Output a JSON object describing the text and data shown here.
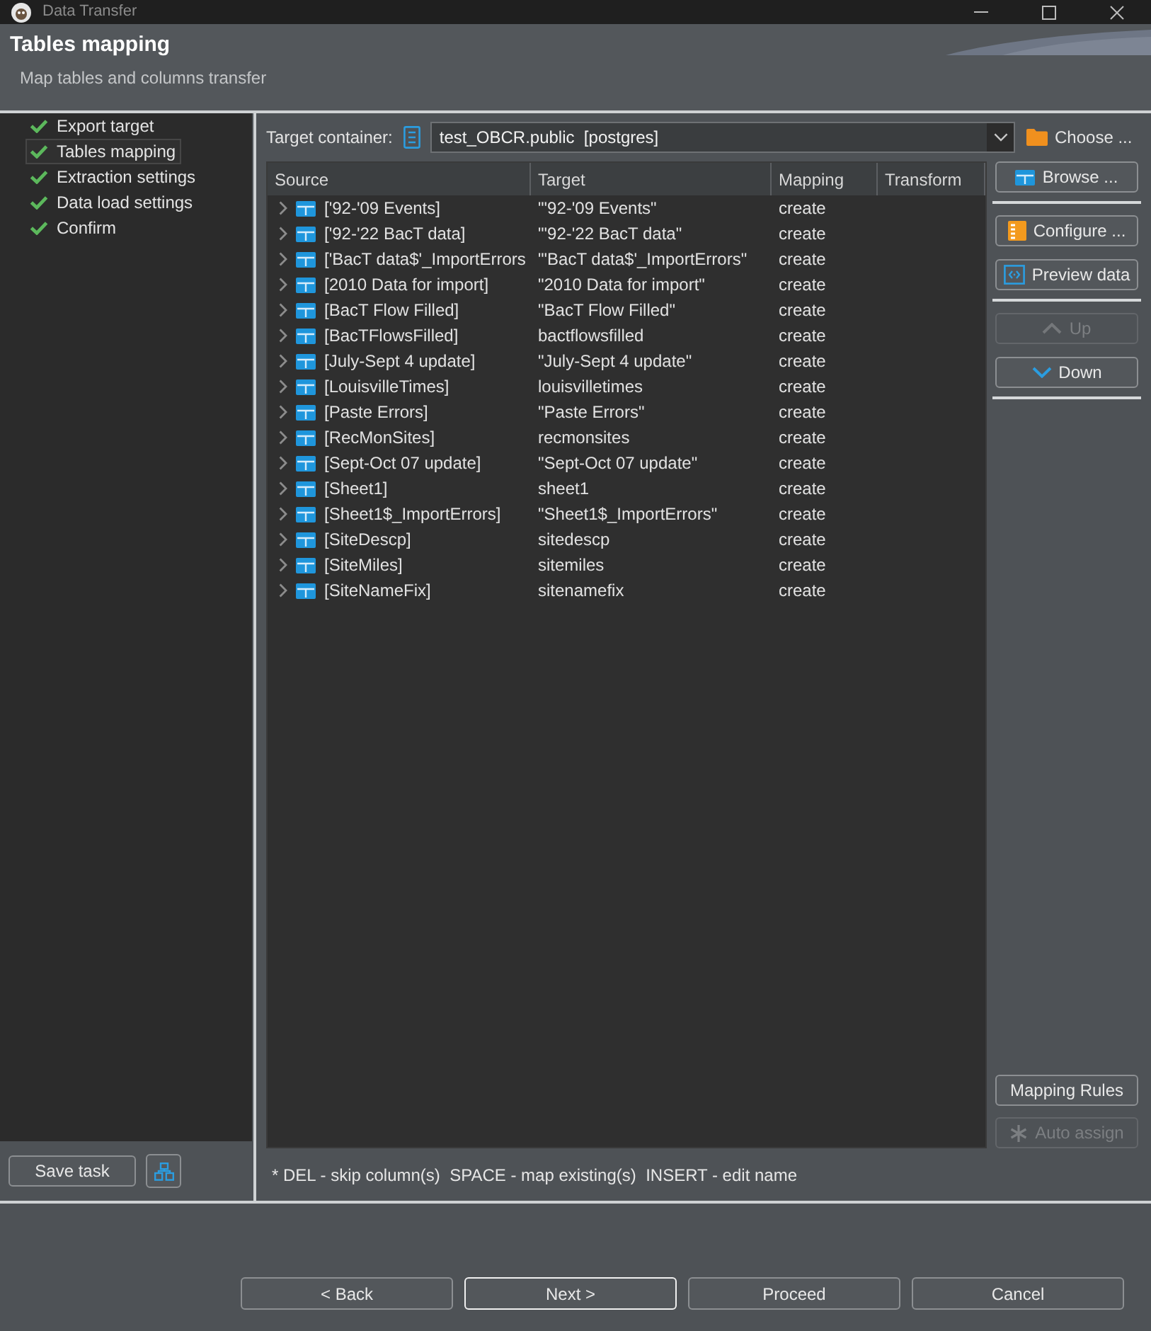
{
  "window": {
    "title": "Data Transfer"
  },
  "header": {
    "title": "Tables mapping",
    "subtitle": "Map tables and columns transfer"
  },
  "steps": [
    {
      "label": "Export target",
      "done": true,
      "selected": false
    },
    {
      "label": "Tables mapping",
      "done": true,
      "selected": true
    },
    {
      "label": "Extraction settings",
      "done": true,
      "selected": false
    },
    {
      "label": "Data load settings",
      "done": true,
      "selected": false
    },
    {
      "label": "Confirm",
      "done": true,
      "selected": false
    }
  ],
  "save_task": {
    "label": "Save task"
  },
  "target_container": {
    "label": "Target container:",
    "value": "test_OBCR.public  [postgres]",
    "choose_label": "Choose ..."
  },
  "table": {
    "columns": [
      "Source",
      "Target",
      "Mapping",
      "Transform"
    ],
    "rows": [
      {
        "source": "['92-'09 Events]",
        "target": "\"'92-'09 Events\"",
        "mapping": "create",
        "expanded": false
      },
      {
        "source": "['92-'22 BacT data]",
        "target": "\"'92-'22 BacT data\"",
        "mapping": "create",
        "expanded": false
      },
      {
        "source": "['BacT data$'_ImportErrors",
        "target": "\"'BacT data$'_ImportErrors\"",
        "mapping": "create",
        "expanded": false
      },
      {
        "source": "[2010 Data for import]",
        "target": "\"2010 Data for import\"",
        "mapping": "create",
        "expanded": false
      },
      {
        "source": "[BacT Flow Filled]",
        "target": "\"BacT Flow Filled\"",
        "mapping": "create",
        "expanded": false
      },
      {
        "source": "[BacTFlowsFilled]",
        "target": "bactflowsfilled",
        "mapping": "create",
        "expanded": false
      },
      {
        "source": "[July-Sept 4 update]",
        "target": "\"July-Sept 4 update\"",
        "mapping": "create",
        "expanded": false
      },
      {
        "source": "[LouisvilleTimes]",
        "target": "louisvilletimes",
        "mapping": "create",
        "expanded": false
      },
      {
        "source": "[Paste Errors]",
        "target": "\"Paste Errors\"",
        "mapping": "create",
        "expanded": false
      },
      {
        "source": "[RecMonSites]",
        "target": "recmonsites",
        "mapping": "create",
        "expanded": false
      },
      {
        "source": "[Sept-Oct 07 update]",
        "target": "\"Sept-Oct 07 update\"",
        "mapping": "create",
        "expanded": false
      },
      {
        "source": "[Sheet1]",
        "target": "sheet1",
        "mapping": "create",
        "expanded": false
      },
      {
        "source": "[Sheet1$_ImportErrors]",
        "target": "\"Sheet1$_ImportErrors\"",
        "mapping": "create",
        "expanded": false
      },
      {
        "source": "[SiteDescp]",
        "target": "sitedescp",
        "mapping": "create",
        "expanded": false
      },
      {
        "source": "[SiteMiles]",
        "target": "sitemiles",
        "mapping": "create",
        "expanded": false
      },
      {
        "source": "[SiteNameFix]",
        "target": "sitenamefix",
        "mapping": "create",
        "expanded": false
      }
    ]
  },
  "side_groups": [
    {
      "buttons": [
        {
          "kind": "browse",
          "label": "Browse ...",
          "disabled": false
        }
      ]
    },
    {
      "buttons": [
        {
          "kind": "configure",
          "label": "Configure ...",
          "disabled": false
        },
        {
          "kind": "preview",
          "label": "Preview data",
          "disabled": false
        }
      ]
    },
    {
      "buttons": [
        {
          "kind": "up",
          "label": "Up",
          "disabled": true
        },
        {
          "kind": "down",
          "label": "Down",
          "disabled": false
        }
      ]
    }
  ],
  "side_bottom": [
    {
      "kind": "rules",
      "label": "Mapping Rules",
      "disabled": false
    },
    {
      "kind": "auto",
      "label": "Auto assign",
      "disabled": true
    }
  ],
  "hint": "* DEL - skip column(s)  SPACE - map existing(s)  INSERT - edit name",
  "footer_buttons": [
    {
      "label": "< Back",
      "focused": false
    },
    {
      "label": "Next >",
      "focused": true
    },
    {
      "label": "Proceed",
      "focused": false
    },
    {
      "label": "Cancel",
      "focused": false
    }
  ]
}
